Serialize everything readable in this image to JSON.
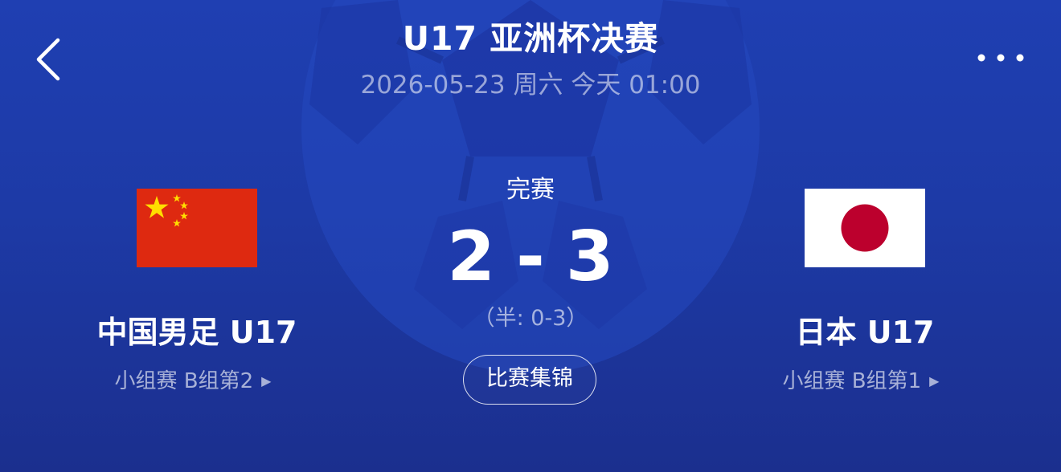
{
  "header": {
    "title": "U17 亚洲杯决赛",
    "datetime": "2026-05-23 周六 今天 01:00",
    "back_icon": "chevron-left-icon",
    "more_icon": "more-dots-icon"
  },
  "match": {
    "status": "完赛",
    "home_score": "2",
    "separator": "-",
    "away_score": "3",
    "halftime": "（半: 0-3）",
    "highlights_label": "比赛集锦"
  },
  "home_team": {
    "name": "中国男足 U17",
    "rank": "小组赛 B组第2",
    "flag": "china-flag-icon",
    "arrow": "▶"
  },
  "away_team": {
    "name": "日本 U17",
    "rank": "小组赛 B组第1",
    "flag": "japan-flag-icon",
    "arrow": "▶"
  },
  "colors": {
    "background_top": "#1f3fb2",
    "background_bottom": "#1b2f8e",
    "china_red": "#de2910",
    "china_star": "#ffde00",
    "japan_red": "#bc002d"
  }
}
